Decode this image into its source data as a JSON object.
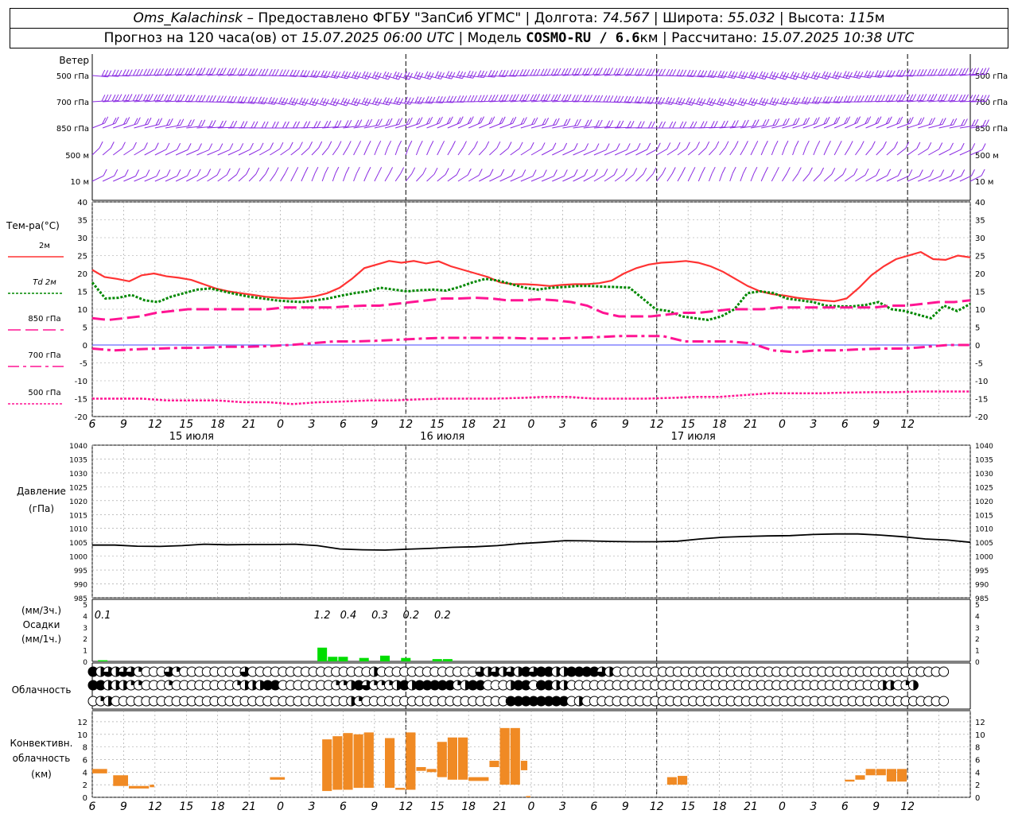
{
  "header": {
    "station": "Oms_Kalachinsk",
    "dash": " – ",
    "provided": "Предоставлено ФГБУ \"ЗапСиб УГМС\"",
    "sep": " | ",
    "lon_label": "Долгота: ",
    "lon": "74.567",
    "lat_label": "Широта: ",
    "lat": "55.032",
    "alt_label": "Высота: ",
    "alt": "115",
    "alt_unit": "м",
    "forecast_prefix": "Прогноз на 120 часа(ов) от ",
    "forecast_from": "15.07.2025 06:00 UTC",
    "model_label": "Модель ",
    "model": "COSMO-RU / 6.6",
    "model_unit": "км",
    "computed_label": "Рассчитано: ",
    "computed": "15.07.2025 10:38 UTC"
  },
  "colors": {
    "t2m": "#ff3333",
    "td2m": "#008800",
    "t850": "#ff1493",
    "t700": "#ff1493",
    "t500": "#ff1493",
    "wind": "#8a2be2",
    "precip": "#00dd00",
    "convective": "#f08a24",
    "pressure": "#000000"
  },
  "time_axis": {
    "hours": [
      "6",
      "9",
      "12",
      "15",
      "18",
      "21",
      "0",
      "3",
      "6",
      "9",
      "12",
      "15",
      "18",
      "21",
      "0",
      "3",
      "6",
      "9",
      "12",
      "15",
      "18",
      "21",
      "0",
      "3",
      "6",
      "9",
      "12"
    ],
    "days": [
      "15 июля",
      "16 июля",
      "17 июля"
    ]
  },
  "wind_panel": {
    "title": "Ветер",
    "levels": [
      "500 гПа",
      "700 гПа",
      "850 гПа",
      "500 м",
      "10  м"
    ]
  },
  "chart_data": [
    {
      "type": "line",
      "title": "Тем-ра(°C)",
      "ylim": [
        -20,
        40
      ],
      "yticks": [
        40,
        35,
        30,
        25,
        20,
        15,
        10,
        5,
        0,
        -5,
        -10,
        -15,
        -20
      ],
      "x_hours_from_start": [
        0,
        1,
        2,
        3,
        4,
        5,
        6,
        7,
        8,
        9,
        10,
        11,
        12,
        13,
        14,
        15,
        16,
        17,
        18,
        19,
        20,
        21,
        22,
        23,
        24,
        25,
        26,
        27,
        28,
        29,
        30,
        31,
        32,
        33,
        34,
        35,
        36,
        37,
        38,
        39,
        40,
        41,
        42,
        43,
        44,
        45,
        46,
        47,
        48,
        49,
        50,
        51,
        52,
        53,
        54,
        55,
        56,
        57,
        58,
        59,
        60,
        61,
        62,
        63,
        64,
        65,
        66,
        67,
        68,
        69,
        70,
        71,
        72,
        73,
        74,
        75,
        76,
        77,
        78,
        79,
        80,
        81,
        82,
        83,
        84
      ],
      "series": [
        {
          "name": "2м",
          "style": "solid",
          "values": [
            21,
            19,
            18.5,
            17.8,
            19.5,
            20,
            19.2,
            18.8,
            18.2,
            17,
            15.8,
            15,
            14.5,
            14,
            13.5,
            13.2,
            13,
            13.2,
            13.6,
            14.5,
            16,
            18.5,
            21.5,
            22.5,
            23.5,
            23,
            23.5,
            22.8,
            23.4,
            22,
            21,
            20,
            19,
            17.5,
            17,
            17,
            16.8,
            16.5,
            16.8,
            17,
            17,
            17.3,
            18,
            20,
            21.5,
            22.5,
            23,
            23.2,
            23.5,
            23,
            22,
            20.5,
            18.5,
            16.5,
            15,
            14.2,
            13.8,
            13.2,
            12.8,
            12.5,
            12.2,
            13,
            16,
            19.5,
            22,
            24,
            25,
            26,
            24,
            23.8,
            25,
            24.5
          ]
        },
        {
          "name": "Td",
          "label": "Td  2м",
          "style": "dotted",
          "values": [
            17.5,
            13,
            13.2,
            14,
            12.5,
            12,
            13.5,
            14.5,
            15.5,
            15.8,
            15,
            14.2,
            13.5,
            13,
            12.5,
            12.2,
            12,
            12.5,
            13,
            13.8,
            14.5,
            15,
            16,
            15.5,
            15,
            15.3,
            15.5,
            15.2,
            16.2,
            17.5,
            18.5,
            18,
            17,
            16,
            15.5,
            16,
            16.2,
            16.5,
            16.5,
            16.3,
            16.2,
            16,
            13,
            10,
            9.5,
            8,
            7.5,
            7,
            8,
            10,
            14.5,
            15,
            14.5,
            13,
            12.5,
            12,
            11,
            10.8,
            10.8,
            11.2,
            12,
            10,
            9.5,
            8.5,
            7.5,
            11,
            9.5,
            11.5
          ]
        },
        {
          "name": "850 гПа",
          "style": "dashed",
          "values": [
            7.5,
            7,
            7.5,
            8,
            9,
            9.5,
            10,
            10,
            10,
            10,
            10,
            10,
            10.5,
            10.5,
            10.5,
            10.5,
            10.8,
            11,
            11,
            11.5,
            12,
            12.5,
            13,
            13,
            13.2,
            13,
            12.5,
            12.5,
            12.8,
            12.5,
            12,
            11,
            9,
            8,
            8,
            8,
            8.5,
            9,
            9,
            9.5,
            10,
            10,
            10,
            10.5,
            10.5,
            10.5,
            10.5,
            10.5,
            10.5,
            10.5,
            11,
            11,
            11.5,
            12,
            12,
            12.5
          ]
        },
        {
          "name": "700 гПа",
          "style": "dashdot",
          "values": [
            -1,
            -1.5,
            -1.2,
            -1,
            -0.8,
            -0.8,
            -0.5,
            -0.5,
            -0.3,
            0,
            0.5,
            1,
            1,
            1.2,
            1.5,
            1.8,
            2,
            2,
            2,
            2,
            1.8,
            1.8,
            2,
            2.2,
            2.5,
            2.5,
            2.5,
            1,
            1,
            1,
            0.5,
            -1.5,
            -2,
            -1.5,
            -1.5,
            -1.2,
            -1,
            -1,
            -0.5,
            0,
            0
          ]
        },
        {
          "name": "500 гПа",
          "style": "dotted",
          "values": [
            -15,
            -15,
            -15,
            -15.5,
            -15.5,
            -15.5,
            -16,
            -16,
            -16.5,
            -16,
            -15.8,
            -15.5,
            -15.5,
            -15.2,
            -15,
            -15,
            -15,
            -14.8,
            -14.5,
            -14.5,
            -15,
            -15,
            -15,
            -14.8,
            -14.5,
            -14.5,
            -14,
            -13.5,
            -13.5,
            -13.5,
            -13.3,
            -13.2,
            -13.2,
            -13,
            -13,
            -13
          ]
        }
      ]
    },
    {
      "type": "line",
      "title": "Давление",
      "ylabel": "(гПа)",
      "ylim": [
        985,
        1040
      ],
      "yticks": [
        1040,
        1035,
        1030,
        1025,
        1020,
        1015,
        1010,
        1005,
        1000,
        995,
        990,
        985
      ],
      "series": [
        {
          "name": "Давление",
          "values": [
            1004,
            1004,
            1003.6,
            1003.5,
            1003.8,
            1004.3,
            1004.1,
            1004.2,
            1004.2,
            1004.3,
            1003.8,
            1002.6,
            1002.3,
            1002.2,
            1002.5,
            1002.8,
            1003.2,
            1003.4,
            1003.8,
            1004.5,
            1005,
            1005.6,
            1005.5,
            1005.3,
            1005.2,
            1005.2,
            1005.4,
            1006.2,
            1006.8,
            1007.1,
            1007.3,
            1007.4,
            1007.8,
            1008,
            1008,
            1007.6,
            1007,
            1006.2,
            1005.8,
            1005
          ]
        }
      ]
    },
    {
      "type": "bar",
      "title": "Осадки",
      "ylabel_top": "(мм/3ч.)",
      "ylabel_bottom": "(мм/1ч.)",
      "ylim": [
        0,
        5
      ],
      "yticks": [
        5,
        4,
        3,
        2,
        1,
        0
      ],
      "totals_3h": [
        {
          "hour": "9",
          "value": "0.1"
        },
        {
          "hour": "6",
          "value": "1.2"
        },
        {
          "hour": "9",
          "value": "0.4"
        },
        {
          "hour": "12",
          "value": "0.3"
        },
        {
          "hour": "15",
          "value": "0.2"
        },
        {
          "hour": "18",
          "value": "0.2"
        }
      ],
      "hourly": [
        {
          "x": 1,
          "v": 0.1
        },
        {
          "x": 22,
          "v": 1.2
        },
        {
          "x": 23,
          "v": 0.4
        },
        {
          "x": 24,
          "v": 0.4
        },
        {
          "x": 26,
          "v": 0.3
        },
        {
          "x": 28,
          "v": 0.5
        },
        {
          "x": 30,
          "v": 0.3
        },
        {
          "x": 33,
          "v": 0.2
        },
        {
          "x": 34,
          "v": 0.2
        }
      ]
    },
    {
      "type": "bar",
      "title": "Конвективн. облачность",
      "ylabel": "(км)",
      "ylim": [
        0,
        13
      ],
      "yticks": [
        12,
        10,
        8,
        6,
        4,
        2,
        0
      ],
      "intervals": [
        {
          "x0": 0,
          "x1": 1.5,
          "lo": 3.8,
          "hi": 4.5
        },
        {
          "x0": 2,
          "x1": 3.5,
          "lo": 1.8,
          "hi": 3.5
        },
        {
          "x0": 3.5,
          "x1": 5.5,
          "lo": 1.4,
          "hi": 1.8
        },
        {
          "x0": 5.5,
          "x1": 6,
          "lo": 1.6,
          "hi": 2
        },
        {
          "x0": 17,
          "x1": 18.5,
          "lo": 2.8,
          "hi": 3.2
        },
        {
          "x0": 22,
          "x1": 23,
          "lo": 1,
          "hi": 9.2
        },
        {
          "x0": 23,
          "x1": 24,
          "lo": 1.2,
          "hi": 9.7
        },
        {
          "x0": 24,
          "x1": 25,
          "lo": 1.2,
          "hi": 10.2
        },
        {
          "x0": 25,
          "x1": 26,
          "lo": 1.5,
          "hi": 10
        },
        {
          "x0": 26,
          "x1": 27,
          "lo": 1.5,
          "hi": 10.3
        },
        {
          "x0": 28,
          "x1": 29,
          "lo": 1.5,
          "hi": 9.4
        },
        {
          "x0": 29,
          "x1": 30,
          "lo": 1.2,
          "hi": 1.5
        },
        {
          "x0": 30,
          "x1": 31,
          "lo": 1.2,
          "hi": 10.3
        },
        {
          "x0": 31,
          "x1": 32,
          "lo": 4.2,
          "hi": 4.8
        },
        {
          "x0": 32,
          "x1": 33,
          "lo": 4,
          "hi": 4.5
        },
        {
          "x0": 33,
          "x1": 34,
          "lo": 3.2,
          "hi": 8.8
        },
        {
          "x0": 34,
          "x1": 35,
          "lo": 2.8,
          "hi": 9.5
        },
        {
          "x0": 35,
          "x1": 36,
          "lo": 2.8,
          "hi": 9.5
        },
        {
          "x0": 36,
          "x1": 38,
          "lo": 2.6,
          "hi": 3.2
        },
        {
          "x0": 38,
          "x1": 39,
          "lo": 4.8,
          "hi": 5.8
        },
        {
          "x0": 39,
          "x1": 40,
          "lo": 2,
          "hi": 11
        },
        {
          "x0": 40,
          "x1": 41,
          "lo": 2,
          "hi": 11
        },
        {
          "x0": 41,
          "x1": 41.7,
          "lo": 4.3,
          "hi": 5.8
        },
        {
          "x0": 41.5,
          "x1": 42,
          "lo": 0,
          "hi": 0.2
        },
        {
          "x0": 55,
          "x1": 56,
          "lo": 2,
          "hi": 3.2
        },
        {
          "x0": 56,
          "x1": 57,
          "lo": 2,
          "hi": 3.4
        },
        {
          "x0": 72,
          "x1": 73,
          "lo": 2.5,
          "hi": 2.8
        },
        {
          "x0": 73,
          "x1": 74,
          "lo": 2.8,
          "hi": 3.5
        },
        {
          "x0": 74,
          "x1": 75,
          "lo": 3.5,
          "hi": 4.5
        },
        {
          "x0": 75,
          "x1": 76,
          "lo": 3.5,
          "hi": 4.5
        },
        {
          "x0": 76,
          "x1": 77,
          "lo": 2.5,
          "hi": 4.5
        },
        {
          "x0": 77,
          "x1": 78,
          "lo": 2.5,
          "hi": 4.5
        }
      ]
    }
  ],
  "cloud_panel": {
    "title": "Облачность",
    "rows": [
      "fHDHTDQoooDQooooooooTooooooooooooooooHooooooooooooEDHDHDHfTffHHffffDHoooooooooooooooooooooooooooooooooooooooooooo",
      "ffHHHqQoooqooooooooqHHHffoooooooqQHfDqqQHfHfffffQHffEEEHffEffHHoooooooooooooooooooooooooooooooooooooooooHHoQH",
      "oqHoooooooooooooooooooooooooooooooHqoooooooooooooooooooffffffffoHoooooooooooooooooooooooooooooooooooooooooooooooo"
    ]
  },
  "legend": [
    {
      "label": "2м",
      "style": "solid",
      "color": "#ff3333"
    },
    {
      "label": "Td  2м",
      "style": "dotted",
      "color": "#008800"
    },
    {
      "label": "850 гПа",
      "style": "dashed",
      "color": "#ff1493"
    },
    {
      "label": "700 гПа",
      "style": "dashdot",
      "color": "#ff1493"
    },
    {
      "label": "500 гПа",
      "style": "dotted",
      "color": "#ff1493"
    }
  ]
}
